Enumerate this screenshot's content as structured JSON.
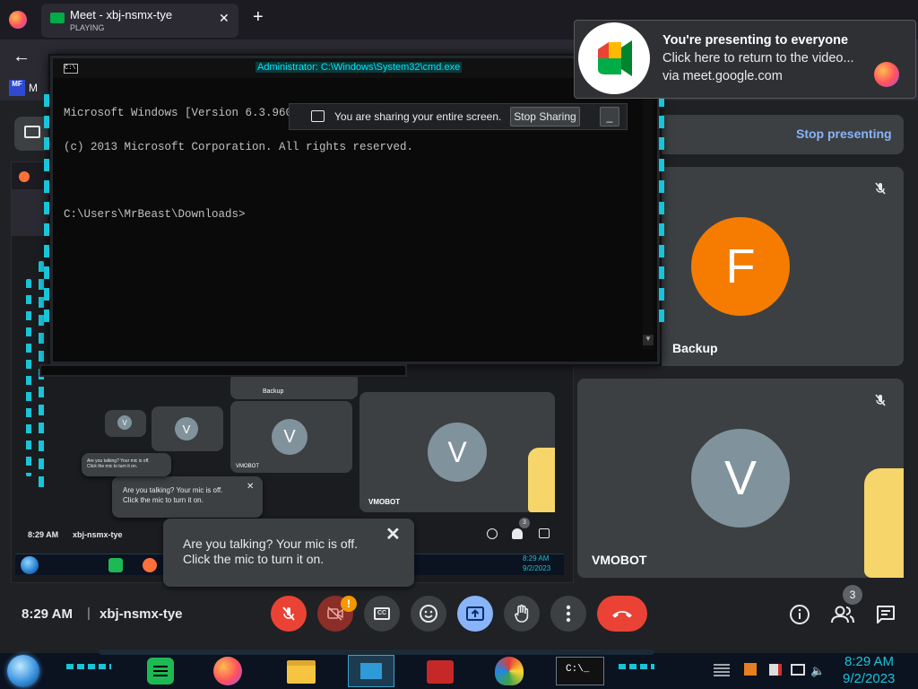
{
  "browser": {
    "tab_title": "Meet - xbj-nsmx-tye",
    "tab_status": "PLAYING",
    "bookmark_initials": "MF"
  },
  "colors": {
    "meet_bg": "#202124",
    "tile_bg": "#3c4043",
    "avatar_f": "#f57c00",
    "avatar_v": "#80929c",
    "red": "#ea4335",
    "blue_present": "#8ab4f8",
    "cmd_title_cyan": "#00e5ff"
  },
  "cmd": {
    "title": "Administrator: C:\\Windows\\System32\\cmd.exe",
    "line1": "Microsoft Windows [Version 6.3.9600]",
    "line2": "(c) 2013 Microsoft Corporation. All rights reserved.",
    "line3": "C:\\Users\\MrBeast\\Downloads>"
  },
  "sharebar": {
    "text": "You are sharing your entire screen.",
    "stop_label": "Stop Sharing",
    "hide_label": "_"
  },
  "notification": {
    "title": "You're presenting to everyone",
    "body": "Click here to return to the video...",
    "source": "via meet.google.com"
  },
  "presenting": {
    "stop_label": "Stop presenting"
  },
  "tiles": {
    "backup": {
      "initial": "F",
      "name": "Backup"
    },
    "vmobot": {
      "initial": "V",
      "name": "VMOBOT"
    }
  },
  "toast": {
    "line1": "Are you talking? Your mic is off.",
    "line2": "Click the mic to turn it on.",
    "close": "✕"
  },
  "bottom": {
    "time": "8:29 AM",
    "separator": "|",
    "meeting_code": "xbj-nsmx-tye",
    "people_count": "3",
    "cam_warning": "!"
  },
  "nested": {
    "time": "8:29 AM",
    "code": "xbj-nsmx-tye",
    "vm_name": "VMOBOT",
    "vm_initial": "V",
    "backup_name": "Backup",
    "count": "3",
    "tray_time": "8:29 AM",
    "tray_date": "9/2/2023"
  },
  "taskbar": {
    "time": "8:29 AM",
    "date": "9/2/2023",
    "cmd_label": "C:\\_"
  }
}
